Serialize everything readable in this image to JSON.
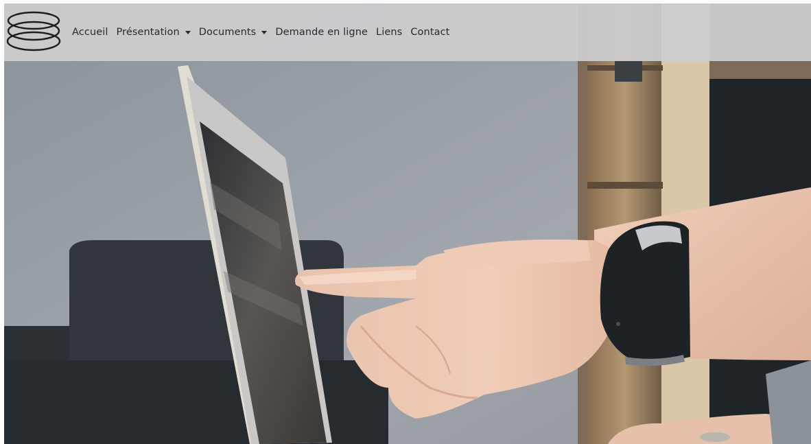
{
  "nav": {
    "items": [
      {
        "label": "Accueil",
        "dropdown": false
      },
      {
        "label": "Présentation",
        "dropdown": true
      },
      {
        "label": "Documents",
        "dropdown": true
      },
      {
        "label": "Demande en ligne",
        "dropdown": false
      },
      {
        "label": "Liens",
        "dropdown": false
      },
      {
        "label": "Contact",
        "dropdown": false
      }
    ]
  },
  "icons": {
    "logo": "stacked-rings-logo",
    "dropdown": "caret-down-icon"
  },
  "colors": {
    "navbar_bg": "#cdcdd0",
    "nav_text": "#2a2a2a",
    "logo_stroke": "#1e1e1e"
  }
}
